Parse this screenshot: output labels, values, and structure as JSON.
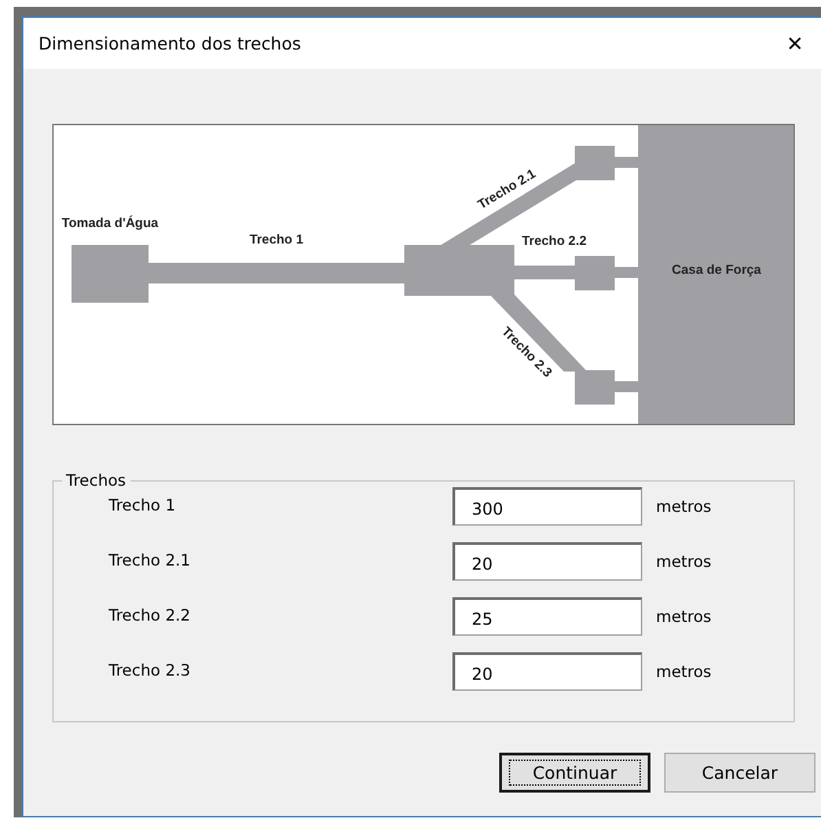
{
  "window": {
    "title": "Dimensionamento dos trechos",
    "close_glyph": "✕"
  },
  "diagram": {
    "intake_label": "Tomada d'Água",
    "powerhouse_label": "Casa de Força",
    "pipe_labels": [
      "Trecho 1",
      "Trecho 2.1",
      "Trecho 2.2",
      "Trecho 2.3"
    ]
  },
  "group": {
    "title": "Trechos",
    "rows": [
      {
        "label": "Trecho 1",
        "value": "300",
        "unit": "metros"
      },
      {
        "label": "Trecho 2.1",
        "value": "20",
        "unit": "metros"
      },
      {
        "label": "Trecho 2.2",
        "value": "25",
        "unit": "metros"
      },
      {
        "label": "Trecho 2.3",
        "value": "20",
        "unit": "metros"
      }
    ]
  },
  "buttons": [
    {
      "label": "Continuar",
      "default": true
    },
    {
      "label": "Cancelar",
      "default": false
    }
  ]
}
